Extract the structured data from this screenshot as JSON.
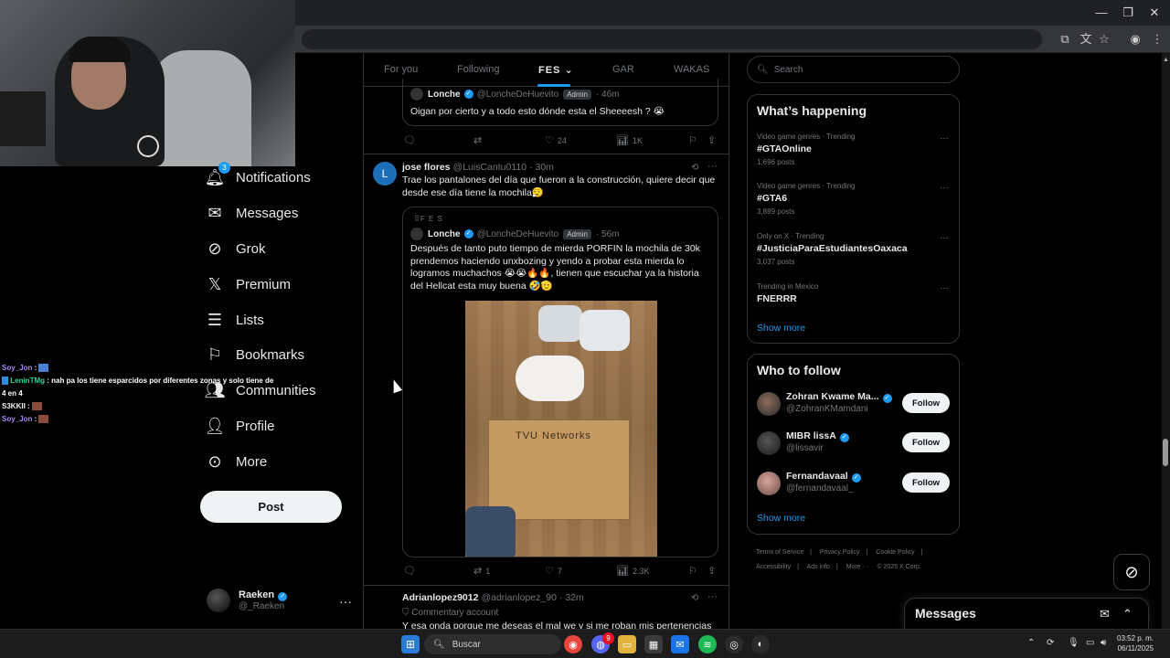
{
  "nav": {
    "items": [
      {
        "label": "Notifications",
        "icon": "bell-icon",
        "badge": "3"
      },
      {
        "label": "Messages",
        "icon": "envelope-icon"
      },
      {
        "label": "Grok",
        "icon": "grok-icon"
      },
      {
        "label": "Premium",
        "icon": "x-logo-icon"
      },
      {
        "label": "Lists",
        "icon": "list-icon"
      },
      {
        "label": "Bookmarks",
        "icon": "bookmark-icon"
      },
      {
        "label": "Communities",
        "icon": "people-icon"
      },
      {
        "label": "Profile",
        "icon": "person-icon"
      },
      {
        "label": "More",
        "icon": "more-circle-icon"
      }
    ],
    "post_label": "Post",
    "account": {
      "name": "Raeken",
      "handle": "@_Raeken"
    }
  },
  "chat": {
    "lines": [
      {
        "user": "Soy_Jon",
        "text": ""
      },
      {
        "user": "LeninTMg",
        "text": "nah pa los tiene esparcidos por diferentes zonas y solo tiene de 4 en 4"
      },
      {
        "user": "S3KKII",
        "text": ""
      },
      {
        "user": "Soy_Jon",
        "text": ""
      }
    ]
  },
  "feed": {
    "tabs": [
      "For you",
      "Following",
      "FES",
      "GAR",
      "WAKAS"
    ],
    "active_tab": "FES",
    "tweet0": {
      "quote": {
        "name": "Lonche",
        "handle": "@LoncheDeHuevito",
        "badge": "Admin",
        "time": "· 46m",
        "text": "Oigan por cierto y a todo esto dónde esta el Sheeeesh ? 😭"
      },
      "stats": {
        "likes": "24",
        "views": "1K"
      }
    },
    "tweet1": {
      "avatar_letter": "L",
      "name": "jose flores",
      "handle": "@LuisCantu0110",
      "time": "· 30m",
      "text": "Trae los pantalones del día que fueron a la construcción, quiere decir que desde ese día tiene la mochila😮‍💨",
      "quote": {
        "community": "F E S",
        "name": "Lonche",
        "handle": "@LoncheDeHuevito",
        "badge": "Admin",
        "time": "· 56m",
        "text": "Después de tanto puto tiempo de mierda PORFIN la mochila de 30k prendemos haciendo unxbozing y yendo a probar esta mierda lo logramos muchachos 😭😭🔥🔥, tienen que escuchar ya la historia del Hellcat esta muy buena 🤣🫡",
        "image_text": "TVU Networks"
      },
      "stats": {
        "replies": "1",
        "likes": "7",
        "views": "2.3K"
      }
    },
    "tweet2": {
      "name": "Adrianlopez9012",
      "handle": "@adrianlopez_90",
      "time": "· 32m",
      "subline": "Commentary account",
      "text": "Y esa onda porque me deseas el mal we y si me roban mis pertenencias"
    }
  },
  "sidebar": {
    "search_placeholder": "Search",
    "happening": {
      "title": "What’s happening",
      "trends": [
        {
          "context": "Video game genres · Trending",
          "name": "#GTAOnline",
          "count": "1,696 posts"
        },
        {
          "context": "Video game genres · Trending",
          "name": "#GTA6",
          "count": "3,889 posts"
        },
        {
          "context": "Only on X · Trending",
          "name": "#JusticiaParaEstudiantesOaxaca",
          "count": "3,037 posts"
        },
        {
          "context": "Trending in Mexico",
          "name": "FNERRR",
          "count": ""
        }
      ],
      "show_more": "Show more"
    },
    "who_to_follow": {
      "title": "Who to follow",
      "users": [
        {
          "name": "Zohran Kwame Ma...",
          "handle": "@ZohranKMamdani",
          "follow": "Follow"
        },
        {
          "name": "MIBR lissA",
          "handle": "@lissavir",
          "follow": "Follow"
        },
        {
          "name": "Fernandavaal",
          "handle": "@fernandavaal_",
          "follow": "Follow"
        }
      ],
      "show_more": "Show more"
    },
    "footer": [
      "Terms of Service",
      "|",
      "Privacy Policy",
      "|",
      "Cookie Policy",
      "|",
      "Accessibility",
      "|",
      "Ads info",
      "|",
      "More ···",
      "© 2025 X Corp."
    ]
  },
  "messages_drawer": {
    "title": "Messages"
  },
  "taskbar": {
    "search_label": "Buscar",
    "notif_badge": "9",
    "time": "03:52 p. m.",
    "date": "06/11/2025"
  },
  "colors": {
    "accent": "#1d9bf0",
    "background": "#000000",
    "border": "#2f3336"
  }
}
